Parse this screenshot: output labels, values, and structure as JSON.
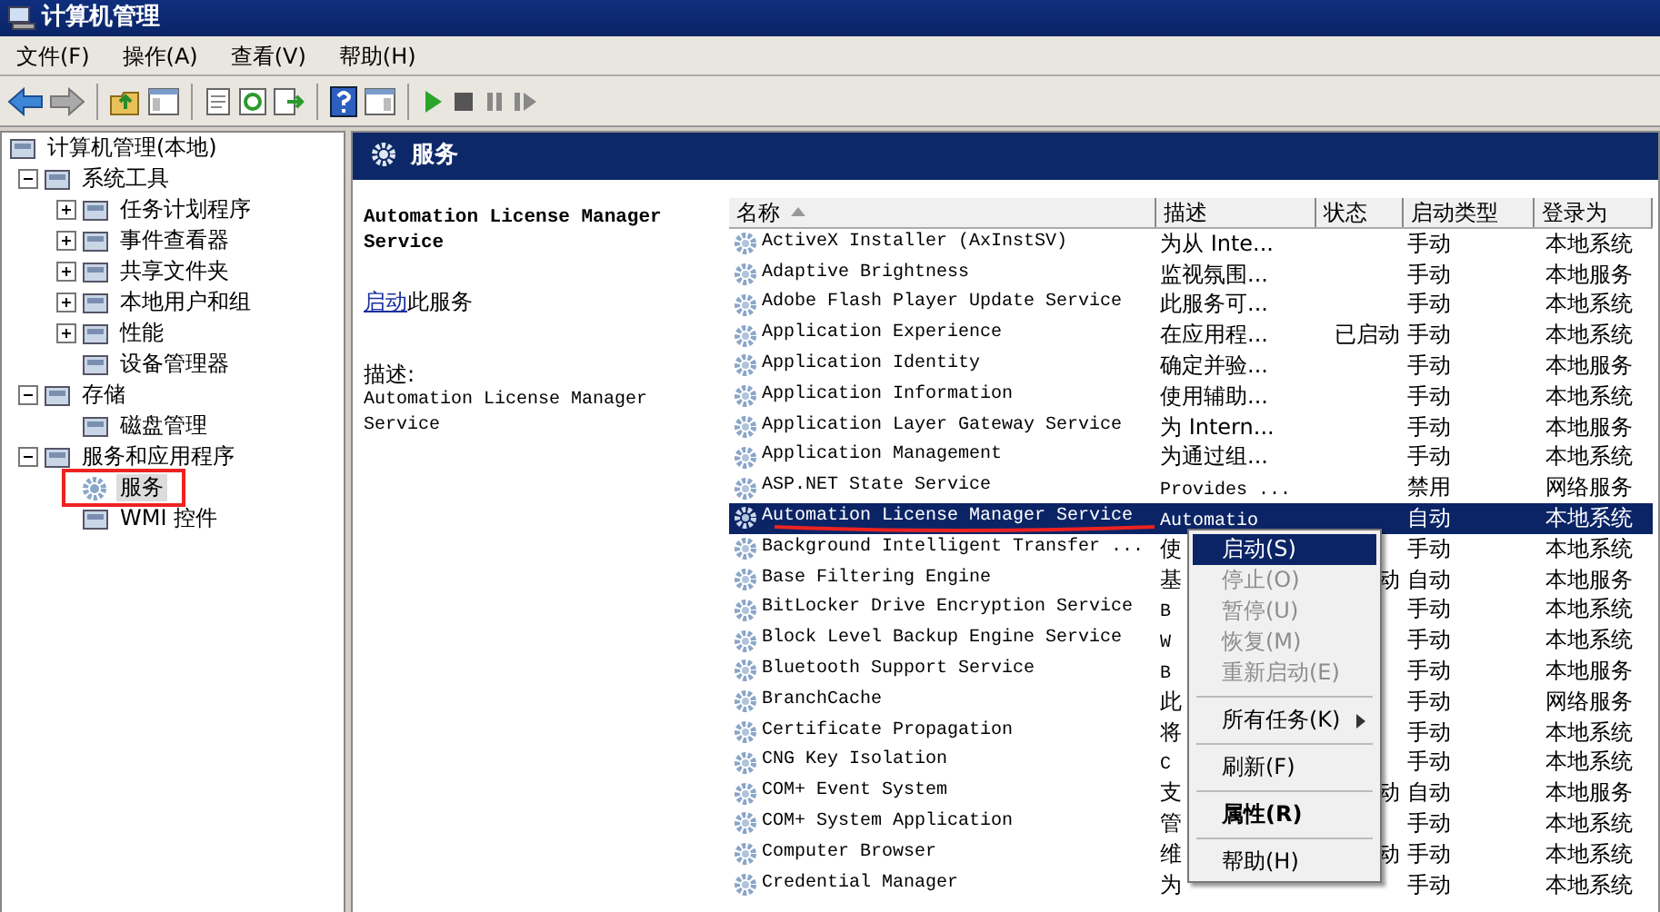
{
  "window": {
    "title": "计算机管理"
  },
  "menu_bar": [
    "文件(F)",
    "操作(A)",
    "查看(V)",
    "帮助(H)"
  ],
  "tree": [
    {
      "label": "计算机管理(本地)",
      "selected": false,
      "children": [
        {
          "label": "系统工具",
          "expanded": true,
          "selected": false,
          "children": [
            {
              "label": "任务计划程序",
              "expanded": false,
              "selected": false
            },
            {
              "label": "事件查看器",
              "expanded": false,
              "selected": false
            },
            {
              "label": "共享文件夹",
              "expanded": false,
              "selected": false
            },
            {
              "label": "本地用户和组",
              "expanded": false,
              "selected": false
            },
            {
              "label": "性能",
              "expanded": false,
              "selected": false
            },
            {
              "label": "设备管理器",
              "selected": false
            }
          ]
        },
        {
          "label": "存储",
          "expanded": true,
          "selected": false,
          "children": [
            {
              "label": "磁盘管理",
              "selected": false
            }
          ]
        },
        {
          "label": "服务和应用程序",
          "expanded": true,
          "selected": false,
          "children": [
            {
              "label": "服务",
              "selected": true
            },
            {
              "label": "WMI 控件",
              "selected": false
            }
          ]
        }
      ]
    }
  ],
  "panel": {
    "title": "服务"
  },
  "details": {
    "service_name": "Automation License Manager Service",
    "action_link": "启动",
    "action_text": "此服务",
    "description_label": "描述:",
    "description": "Automation License Manager Service"
  },
  "table": {
    "columns": [
      {
        "label": "名称",
        "sorted": true
      },
      {
        "label": "描述",
        "sorted": false
      },
      {
        "label": "状态",
        "sorted": false
      },
      {
        "label": "启动类型",
        "sorted": false
      },
      {
        "label": "登录为",
        "sorted": false
      }
    ],
    "rows": [
      {
        "name": "ActiveX Installer (AxInstSV)",
        "description": "为从 Inte...",
        "startup_type": "手动",
        "log_on_as": "本地系统",
        "selected": false
      },
      {
        "name": "Adaptive Brightness",
        "description": "监视氛围...",
        "startup_type": "手动",
        "log_on_as": "本地服务",
        "selected": false
      },
      {
        "name": "Adobe Flash Player Update Service",
        "description": "此服务可...",
        "startup_type": "手动",
        "log_on_as": "本地系统",
        "selected": false
      },
      {
        "name": "Application Experience",
        "description": "在应用程...",
        "status": "已启动",
        "startup_type": "手动",
        "log_on_as": "本地系统",
        "selected": false
      },
      {
        "name": "Application Identity",
        "description": "确定并验...",
        "startup_type": "手动",
        "log_on_as": "本地服务",
        "selected": false
      },
      {
        "name": "Application Information",
        "description": "使用辅助...",
        "startup_type": "手动",
        "log_on_as": "本地系统",
        "selected": false
      },
      {
        "name": "Application Layer Gateway Service",
        "description": "为 Intern...",
        "startup_type": "手动",
        "log_on_as": "本地服务",
        "selected": false
      },
      {
        "name": "Application Management",
        "description": "为通过组...",
        "startup_type": "手动",
        "log_on_as": "本地系统",
        "selected": false
      },
      {
        "name": "ASP.NET State Service",
        "description": "Provides ...",
        "startup_type": "禁用",
        "log_on_as": "网络服务",
        "selected": false
      },
      {
        "name": "Automation License Manager Service",
        "description": "Automatio",
        "startup_type": "自动",
        "log_on_as": "本地系统",
        "selected": true
      },
      {
        "name": "Background Intelligent Transfer ...",
        "description": "使",
        "startup_type": "手动",
        "log_on_as": "本地系统",
        "selected": false
      },
      {
        "name": "Base Filtering Engine",
        "description": "基",
        "status": "动",
        "startup_type": "自动",
        "log_on_as": "本地服务",
        "selected": false
      },
      {
        "name": "BitLocker Drive Encryption Service",
        "description": "B",
        "startup_type": "手动",
        "log_on_as": "本地系统",
        "selected": false
      },
      {
        "name": "Block Level Backup Engine Service",
        "description": "W",
        "startup_type": "手动",
        "log_on_as": "本地系统",
        "selected": false
      },
      {
        "name": "Bluetooth Support Service",
        "description": "B",
        "startup_type": "手动",
        "log_on_as": "本地服务",
        "selected": false
      },
      {
        "name": "BranchCache",
        "description": "此",
        "startup_type": "手动",
        "log_on_as": "网络服务",
        "selected": false
      },
      {
        "name": "Certificate Propagation",
        "description": "将",
        "startup_type": "手动",
        "log_on_as": "本地系统",
        "selected": false
      },
      {
        "name": "CNG Key Isolation",
        "description": "C",
        "startup_type": "手动",
        "log_on_as": "本地系统",
        "selected": false
      },
      {
        "name": "COM+ Event System",
        "description": "支",
        "status": "动",
        "startup_type": "自动",
        "log_on_as": "本地服务",
        "selected": false
      },
      {
        "name": "COM+ System Application",
        "description": "管",
        "startup_type": "手动",
        "log_on_as": "本地系统",
        "selected": false
      },
      {
        "name": "Computer Browser",
        "description": "维",
        "status": "动",
        "startup_type": "手动",
        "log_on_as": "本地系统",
        "selected": false
      },
      {
        "name": "Credential Manager",
        "description": "为",
        "startup_type": "手动",
        "log_on_as": "本地系统",
        "selected": false
      }
    ]
  },
  "context_menu": [
    {
      "kind": "item",
      "label": "启动(S)",
      "selected": true,
      "disabled": false,
      "default": false
    },
    {
      "kind": "item",
      "label": "停止(O)",
      "selected": false,
      "disabled": true,
      "default": false
    },
    {
      "kind": "item",
      "label": "暂停(U)",
      "selected": false,
      "disabled": true,
      "default": false
    },
    {
      "kind": "item",
      "label": "恢复(M)",
      "selected": false,
      "disabled": true,
      "default": false
    },
    {
      "kind": "item",
      "label": "重新启动(E)",
      "selected": false,
      "disabled": true,
      "default": false
    },
    {
      "kind": "separator"
    },
    {
      "kind": "submenu",
      "label": "所有任务(K)",
      "selected": false,
      "disabled": false,
      "default": false
    },
    {
      "kind": "separator"
    },
    {
      "kind": "item",
      "label": "刷新(F)",
      "selected": false,
      "disabled": false,
      "default": false
    },
    {
      "kind": "separator"
    },
    {
      "kind": "item",
      "label": "属性(R)",
      "selected": false,
      "disabled": false,
      "default": true
    },
    {
      "kind": "separator"
    },
    {
      "kind": "item",
      "label": "帮助(H)",
      "selected": false,
      "disabled": false,
      "default": false
    }
  ]
}
